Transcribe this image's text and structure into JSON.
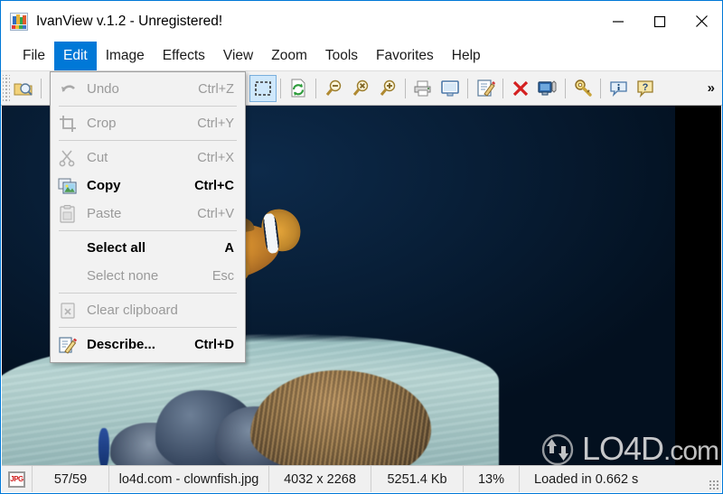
{
  "window": {
    "title": "IvanView v.1.2 - Unregistered!",
    "app_icon": "ivanview-logo-icon",
    "minimize_label": "–",
    "maximize_label": "□",
    "close_label": "✕"
  },
  "menubar": {
    "items": [
      {
        "label": "File",
        "name": "menu-file",
        "active": false
      },
      {
        "label": "Edit",
        "name": "menu-edit",
        "active": true
      },
      {
        "label": "Image",
        "name": "menu-image",
        "active": false
      },
      {
        "label": "Effects",
        "name": "menu-effects",
        "active": false
      },
      {
        "label": "View",
        "name": "menu-view",
        "active": false
      },
      {
        "label": "Zoom",
        "name": "menu-zoom",
        "active": false
      },
      {
        "label": "Tools",
        "name": "menu-tools",
        "active": false
      },
      {
        "label": "Favorites",
        "name": "menu-favorites",
        "active": false
      },
      {
        "label": "Help",
        "name": "menu-help",
        "active": false
      }
    ]
  },
  "toolbar": {
    "overflow_label": "»",
    "buttons": [
      {
        "name": "open-folder-icon",
        "title": "Open"
      },
      {
        "name": "hand-pan-icon",
        "title": "Pan"
      },
      {
        "name": "selection-marquee-icon",
        "title": "Select",
        "selected": true
      },
      {
        "name": "refresh-page-icon",
        "title": "Reload"
      },
      {
        "name": "zoom-out-icon",
        "title": "Zoom out"
      },
      {
        "name": "zoom-reset-icon",
        "title": "Zoom reset"
      },
      {
        "name": "zoom-in-icon",
        "title": "Zoom in"
      },
      {
        "name": "printer-icon",
        "title": "Print"
      },
      {
        "name": "monitor-icon",
        "title": "Full screen"
      },
      {
        "name": "edit-describe-icon",
        "title": "Describe"
      },
      {
        "name": "delete-x-icon",
        "title": "Delete"
      },
      {
        "name": "set-wallpaper-icon",
        "title": "Set as wallpaper"
      },
      {
        "name": "key-icon",
        "title": "Register"
      },
      {
        "name": "info-icon",
        "title": "Info"
      },
      {
        "name": "help-icon",
        "title": "Help"
      }
    ]
  },
  "edit_menu": {
    "items": [
      {
        "type": "item",
        "label": "Undo",
        "shortcut": "Ctrl+Z",
        "icon": "undo-arrow-icon",
        "state": "disabled"
      },
      {
        "type": "separator"
      },
      {
        "type": "item",
        "label": "Crop",
        "shortcut": "Ctrl+Y",
        "icon": "crop-icon",
        "state": "disabled"
      },
      {
        "type": "separator"
      },
      {
        "type": "item",
        "label": "Cut",
        "shortcut": "Ctrl+X",
        "icon": "scissors-icon",
        "state": "disabled"
      },
      {
        "type": "item",
        "label": "Copy",
        "shortcut": "Ctrl+C",
        "icon": "copy-images-icon",
        "state": "enabled"
      },
      {
        "type": "item",
        "label": "Paste",
        "shortcut": "Ctrl+V",
        "icon": "paste-clipboard-icon",
        "state": "disabled"
      },
      {
        "type": "separator"
      },
      {
        "type": "item",
        "label": "Select all",
        "shortcut": "A",
        "icon": "none",
        "state": "enabled"
      },
      {
        "type": "item",
        "label": "Select none",
        "shortcut": "Esc",
        "icon": "none",
        "state": "disabled"
      },
      {
        "type": "separator"
      },
      {
        "type": "item",
        "label": "Clear clipboard",
        "shortcut": "",
        "icon": "clear-clipboard-icon",
        "state": "disabled"
      },
      {
        "type": "separator"
      },
      {
        "type": "item",
        "label": "Describe...",
        "shortcut": "Ctrl+D",
        "icon": "describe-pencil-icon",
        "state": "enabled"
      }
    ]
  },
  "image_view": {
    "subject": "clownfish-photo",
    "background_color": "#000000"
  },
  "statusbar": {
    "file_type_badge": "JPG",
    "image_counter": "57/59",
    "file_name": "lo4d.com - clownfish.jpg",
    "dimensions": "4032 x 2268",
    "file_size": "5251.4 Kb",
    "zoom_level": "13%",
    "load_time": "Loaded in 0.662 s"
  },
  "watermark": {
    "text": "LO4D",
    "suffix": ".com"
  },
  "colors": {
    "accent": "#0078d7",
    "toolbar_bg": "#f2f2f2",
    "menu_bg": "#f2f2f2",
    "status_bg": "#f0f0f0",
    "viewport_bg": "#000000"
  }
}
